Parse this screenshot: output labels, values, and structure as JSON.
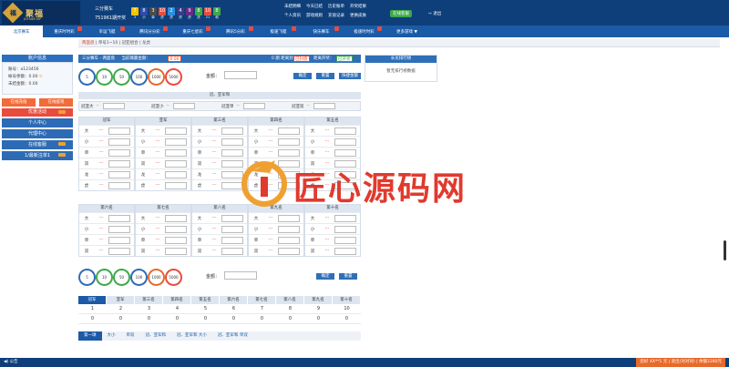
{
  "header": {
    "brand": "聚福",
    "brand_sub": "JUFU88.VIP",
    "game": "三分赛车",
    "issue": "751961期开奖",
    "balls": [
      {
        "n": "7",
        "c": "#f5c400"
      },
      {
        "n": "8",
        "c": "#2d4ca8"
      },
      {
        "n": "3",
        "c": "#4a4a4a"
      },
      {
        "n": "10",
        "c": "#e84c3d"
      },
      {
        "n": "2",
        "c": "#2a8fe0"
      },
      {
        "n": "4",
        "c": "#3a3a8a"
      },
      {
        "n": "9",
        "c": "#6a2a8a"
      },
      {
        "n": "8",
        "c": "#3fa84a"
      },
      {
        "n": "10",
        "c": "#e84c3d"
      },
      {
        "n": "8",
        "c": "#3fa84a"
      }
    ],
    "ball_labels": [
      "3",
      "小",
      "单",
      "虎",
      "虎",
      "虎",
      "虎",
      "虎",
      "21",
      "和"
    ],
    "nav_top": [
      "未结明细",
      "今天已结",
      "历史账单",
      "开奖结果"
    ],
    "nav_bottom": [
      "个人资讯",
      "游戏规则",
      "充值记录",
      "更换皮肤"
    ],
    "green_btn": "在线客服",
    "logout": "退出"
  },
  "tabs": [
    "北京赛车",
    "重庆时时彩",
    "幸运飞艇",
    "腾讯分分彩",
    "重庆七星彩",
    "腾讯5分彩",
    "极速飞艇",
    "快乐赛车",
    "极速时时彩",
    "更多游戏 ▼"
  ],
  "breadcrumb": {
    "home": "两面盘",
    "part1": "单号1~10",
    "part2": "冠亚组合",
    "part3": "龙虎"
  },
  "sidebar": {
    "title": "账户信息",
    "account_label": "账号：",
    "account": "a123456",
    "balance_label": "帐号余额：",
    "balance": "0.00",
    "unsettled_label": "未结金额：",
    "unsettled": "0.00",
    "btn_deposit": "在线充值",
    "btn_withdraw": "在线提现",
    "menu_red": "优惠活动",
    "menu": [
      "个人中心",
      "代理中心",
      "在线客服",
      "1/最新注单1"
    ]
  },
  "bar": {
    "game": "三分赛车",
    "sep": "- ",
    "mode": "两面盘",
    "profit_label": "当前输赢金额：",
    "profit": "0.00",
    "period": "0 期",
    "close_label": "距离封盘：",
    "closed": "已封盘",
    "open_label": "距离开奖：",
    "open": "已开奖"
  },
  "bet": {
    "amount_label": "金额：",
    "btn_confirm": "确定",
    "btn_reset": "重置",
    "btn_quick": "快捷金额"
  },
  "chips": [
    {
      "v": "5",
      "c": "#2d6cb5"
    },
    {
      "v": "10",
      "c": "#3fa84a"
    },
    {
      "v": "50",
      "c": "#3fa84a"
    },
    {
      "v": "100",
      "c": "#2d6cb5"
    },
    {
      "v": "1000",
      "c": "#e86a2a"
    },
    {
      "v": "5000",
      "c": "#e84c3d"
    }
  ],
  "sec_title": "冠、亚军和",
  "big": [
    {
      "l": "冠亚大",
      "o": "--"
    },
    {
      "l": "冠亚小",
      "o": "--"
    },
    {
      "l": "冠亚单",
      "o": "--"
    },
    {
      "l": "冠亚双",
      "o": "--"
    }
  ],
  "pos1": [
    "冠军",
    "亚军",
    "第三名",
    "第四名",
    "第五名"
  ],
  "pos2": [
    "第六名",
    "第七名",
    "第八名",
    "第九名",
    "第十名"
  ],
  "rows": [
    "大",
    "小",
    "单",
    "双",
    "龙",
    "虎"
  ],
  "rows2": [
    "大",
    "小",
    "单",
    "双"
  ],
  "odd": "---",
  "results": {
    "tabs": [
      "冠军",
      "亚军",
      "第三名",
      "第四名",
      "第五名",
      "第六名",
      "第七名",
      "第八名",
      "第九名",
      "第十名"
    ],
    "nums": [
      "1",
      "2",
      "3",
      "4",
      "5",
      "6",
      "7",
      "8",
      "9",
      "10"
    ],
    "vals": [
      "0",
      "0",
      "0",
      "0",
      "0",
      "0",
      "0",
      "0",
      "0",
      "0"
    ]
  },
  "rtabs": [
    "第一球",
    "大小",
    "单双",
    "冠、亚军和",
    "冠、亚军和 大小",
    "冠、亚军和 单双"
  ],
  "rank": {
    "title": "长龙排行榜",
    "body": "暂无排行榜数据"
  },
  "footer": {
    "left": "公告",
    "right": "您好 XX**1 元 | 退出(对对对) | 余额2280元"
  },
  "watermark": "匠心源码网"
}
